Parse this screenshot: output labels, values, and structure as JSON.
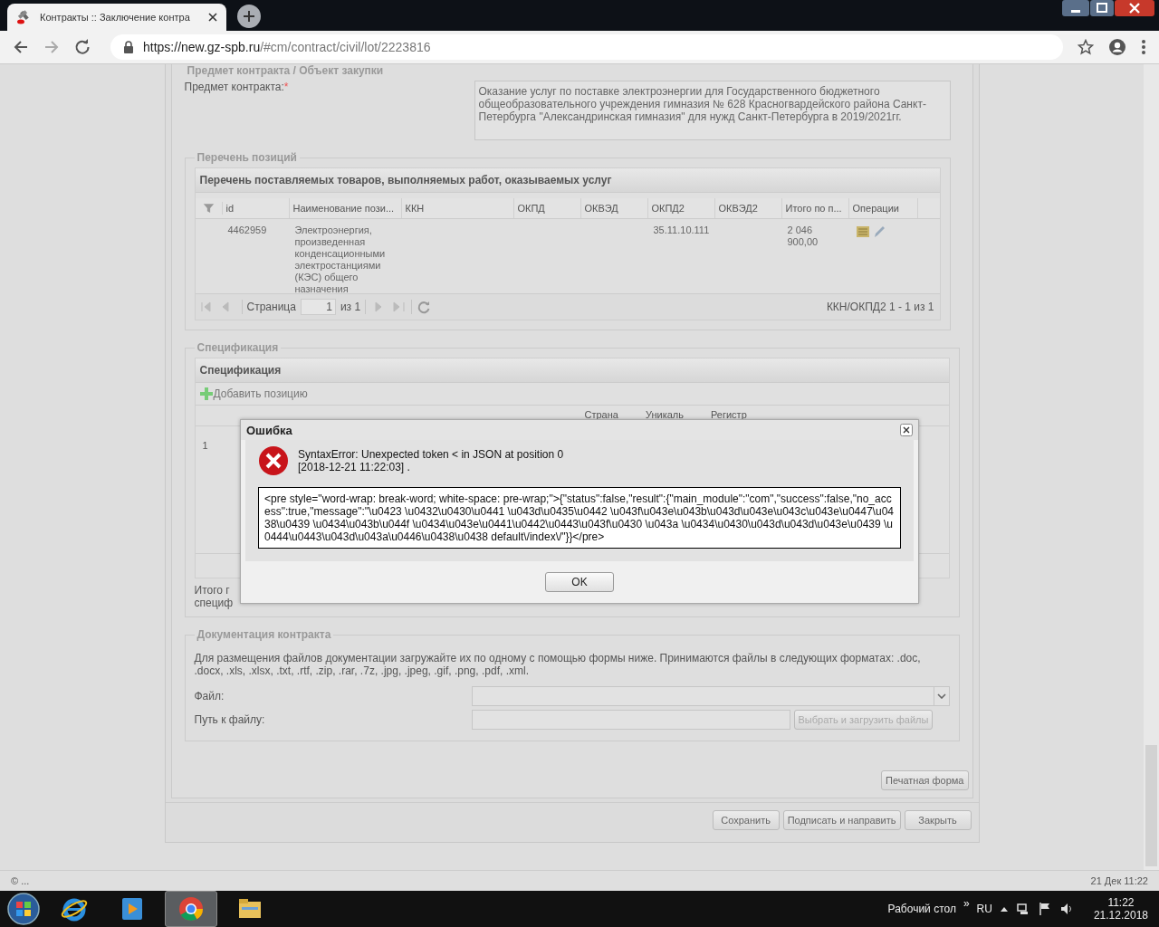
{
  "browser": {
    "tab_title": "Контракты :: Заключение контра",
    "url_host": "https://new.gz-spb.ru",
    "url_path": "/#cm/contract/civil/lot/2223816"
  },
  "subject": {
    "legend": "Предмет контракта / Объект закупки",
    "label": "Предмет контракта:",
    "required_mark": "*",
    "value": "Оказание услуг по поставке электроэнергии для Государственного бюджетного общеобразовательного учреждения гимназия № 628 Красногвардейского района Санкт-Петербурга \"Александринская гимназия\" для нужд Санкт-Петербурга в 2019/2021гг."
  },
  "positions": {
    "legend": "Перечень позиций",
    "title": "Перечень поставляемых товаров, выполняемых работ, оказываемых услуг",
    "columns": [
      "id",
      "Наименование пози...",
      "ККН",
      "ОКПД",
      "ОКВЭД",
      "ОКПД2",
      "ОКВЭД2",
      "Итого по п...",
      "Операции"
    ],
    "rows": [
      {
        "id": "4462959",
        "name": "Электроэнергия, произведенная конденсационными электростанциями (КЭС) общего назначения",
        "okpd2": "35.11.10.111",
        "total": "2 046 900,00"
      }
    ],
    "pager": {
      "page_label": "Страница",
      "page": "1",
      "of": "из 1",
      "summary": "ККН/ОКПД2 1 - 1 из 1"
    }
  },
  "spec": {
    "legend": "Спецификация",
    "title": "Спецификация",
    "add_button": "Добавить позицию",
    "columns_visible": [
      "Страна",
      "Уникаль",
      "Регистр"
    ],
    "row_number": "1",
    "total_lines": [
      "Итого г",
      "специф"
    ]
  },
  "dialog": {
    "title": "Ошибка",
    "message": "SyntaxError: Unexpected token < in JSON at position 0",
    "timestamp": "[2018-12-21 11:22:03] .",
    "details": "<pre style=\"word-wrap: break-word; white-space: pre-wrap;\">{\"status\":false,\"result\":{\"main_module\":\"com\",\"success\":false,\"no_access\":true,\"message\":\"\\u0423 \\u0432\\u0430\\u0441 \\u043d\\u0435\\u0442 \\u043f\\u043e\\u043b\\u043d\\u043e\\u043c\\u043e\\u0447\\u0438\\u0439 \\u0434\\u043b\\u044f \\u0434\\u043e\\u0441\\u0442\\u0443\\u043f\\u0430 \\u043a \\u0434\\u0430\\u043d\\u043d\\u043e\\u0439 \\u0444\\u0443\\u043d\\u043a\\u0446\\u0438\\u0438 default\\/index\\/\"}}</pre>",
    "ok": "OK"
  },
  "docs": {
    "legend": "Документация контракта",
    "hint": "Для размещения файлов документации загружайте их по одному с помощью формы ниже. Принимаются файлы в следующих форматах: .doc, .docx, .xls, .xlsx, .txt, .rtf, .zip, .rar, .7z, .jpg, .jpeg, .gif, .png, .pdf, .xml.",
    "file_label": "Файл:",
    "path_label": "Путь к файлу:",
    "upload_button": "Выбрать и загрузить файлы"
  },
  "print_button": "Печатная форма",
  "actions": [
    "Сохранить",
    "Подписать и направить",
    "Закрыть"
  ],
  "status": {
    "left": "© ...",
    "right": "21 Дек 11:22"
  },
  "taskbar": {
    "apps": [
      {
        "kind": "ie",
        "selected": false
      },
      {
        "kind": "media",
        "selected": false
      },
      {
        "kind": "chrome",
        "selected": true
      },
      {
        "kind": "explorer",
        "selected": false
      }
    ],
    "desktop_label": "Рабочий стол",
    "chevron": "»",
    "lang": "RU",
    "time": "11:22",
    "date": "21.12.2018"
  }
}
